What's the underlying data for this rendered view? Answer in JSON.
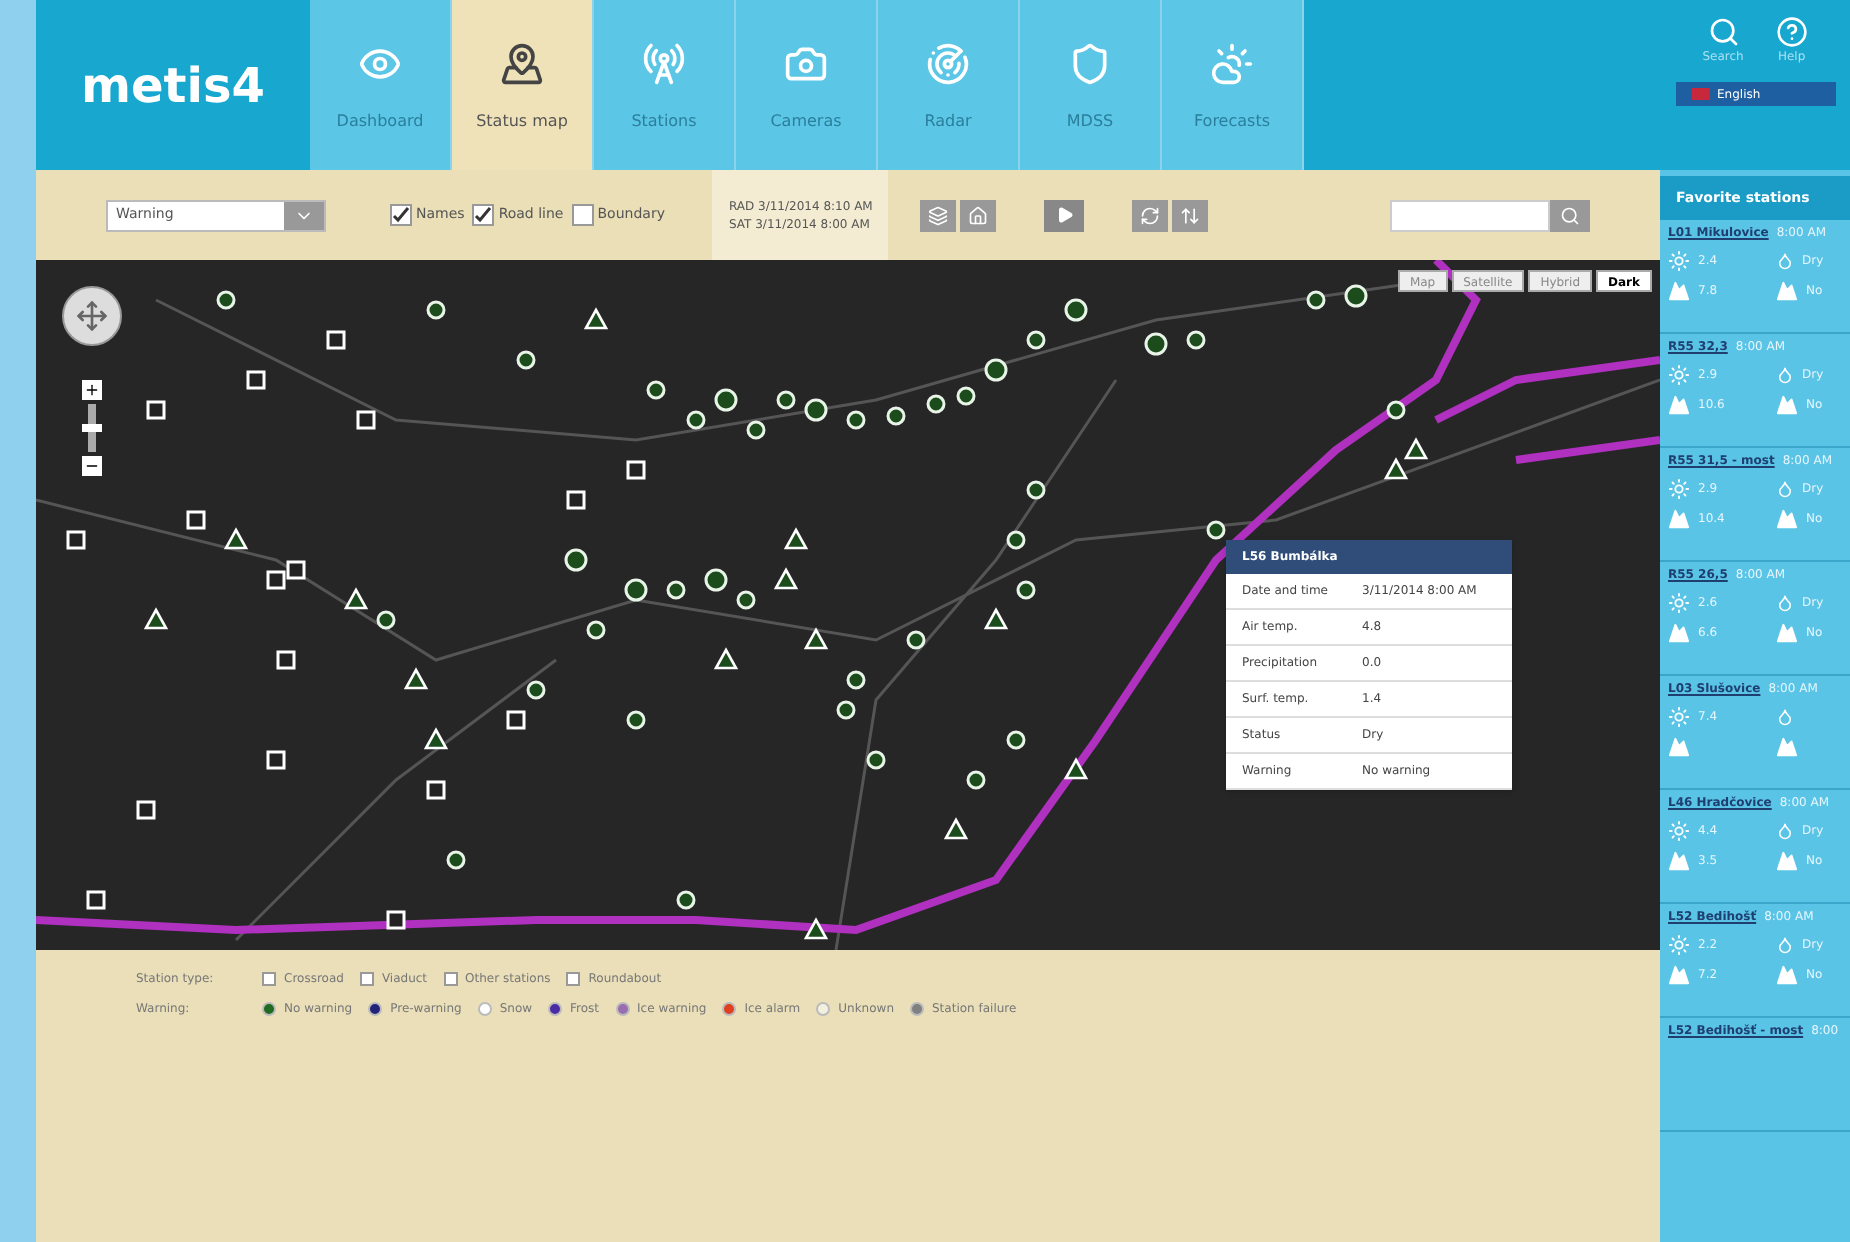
{
  "logo": "metis4",
  "tabs": [
    {
      "label": "Dashboard",
      "selected": false
    },
    {
      "label": "Status map",
      "selected": true
    },
    {
      "label": "Stations",
      "selected": false
    },
    {
      "label": "Cameras",
      "selected": false
    },
    {
      "label": "Radar",
      "selected": false
    },
    {
      "label": "MDSS",
      "selected": false
    },
    {
      "label": "Forecasts",
      "selected": false
    }
  ],
  "header_actions": [
    "Search",
    "Help"
  ],
  "zoom": {
    "level": 0.5
  },
  "language": "English",
  "toolbar": {
    "layer_select": "Warning",
    "toggles": [
      {
        "label": "Names",
        "checked": true
      },
      {
        "label": "Road line",
        "checked": true
      },
      {
        "label": "Boundary",
        "checked": false
      }
    ],
    "timestamps": [
      "RAD 3/11/2014 8:10 AM",
      "SAT 3/11/2014 8:00 AM"
    ]
  },
  "map_types": [
    {
      "label": "Map",
      "selected": false
    },
    {
      "label": "Satellite",
      "selected": false
    },
    {
      "label": "Hybrid",
      "selected": false
    },
    {
      "label": "Dark",
      "selected": true
    }
  ],
  "popup": {
    "title": "L56 Bumbálka",
    "rows": [
      {
        "label": "Date and time",
        "value": "3/11/2014 8:00 AM"
      },
      {
        "label": "Air temp.",
        "value": "4.8"
      },
      {
        "label": "Precipitation",
        "value": "0.0"
      },
      {
        "label": "Surf. temp.",
        "value": "1.4"
      },
      {
        "label": "Status",
        "value": "Dry"
      },
      {
        "label": "Warning",
        "value": "No warning"
      }
    ]
  },
  "legend": {
    "station_type_label": "Station type:",
    "station_types": [
      "Crossroad",
      "Viaduct",
      "Other stations",
      "Roundabout"
    ],
    "warning_label": "Warning:",
    "warnings": [
      {
        "label": "No warning",
        "color": "#1f6b1f"
      },
      {
        "label": "Pre-warning",
        "color": "#23237a"
      },
      {
        "label": "Snow",
        "color": "#ffffff"
      },
      {
        "label": "Frost",
        "color": "#4b2ba3"
      },
      {
        "label": "Ice warning",
        "color": "#9a6cb0"
      },
      {
        "label": "Ice alarm",
        "color": "#e0401f"
      },
      {
        "label": "Unknown",
        "color": "#f4f0e0"
      },
      {
        "label": "Station failure",
        "color": "#808080"
      }
    ]
  },
  "favorites": {
    "title": "Favorite stations",
    "stations": [
      {
        "name": "L01 Mikulovice",
        "time": "8:00 AM",
        "air": "2.4",
        "road": "7.8",
        "status": "Dry",
        "warning": "No"
      },
      {
        "name": "R55 32,3",
        "time": "8:00 AM",
        "air": "2.9",
        "road": "10.6",
        "status": "Dry",
        "warning": "No"
      },
      {
        "name": "R55 31,5 - most",
        "time": "8:00 AM",
        "air": "2.9",
        "road": "10.4",
        "status": "Dry",
        "warning": "No"
      },
      {
        "name": "R55 26,5",
        "time": "8:00 AM",
        "air": "2.6",
        "road": "6.6",
        "status": "Dry",
        "warning": "No"
      },
      {
        "name": "L03 Slušovice",
        "time": "8:00 AM",
        "air": "7.4"
      },
      {
        "name": "L46 Hradčovice",
        "time": "8:00 AM",
        "air": "4.4",
        "road": "3.5",
        "status": "Dry",
        "warning": "No"
      },
      {
        "name": "L52 Bedihošť",
        "time": "8:00 AM",
        "air": "2.2",
        "road": "7.2",
        "status": "Dry",
        "warning": "No"
      },
      {
        "name": "L52 Bedihošť - most",
        "time": "8:00"
      }
    ]
  }
}
